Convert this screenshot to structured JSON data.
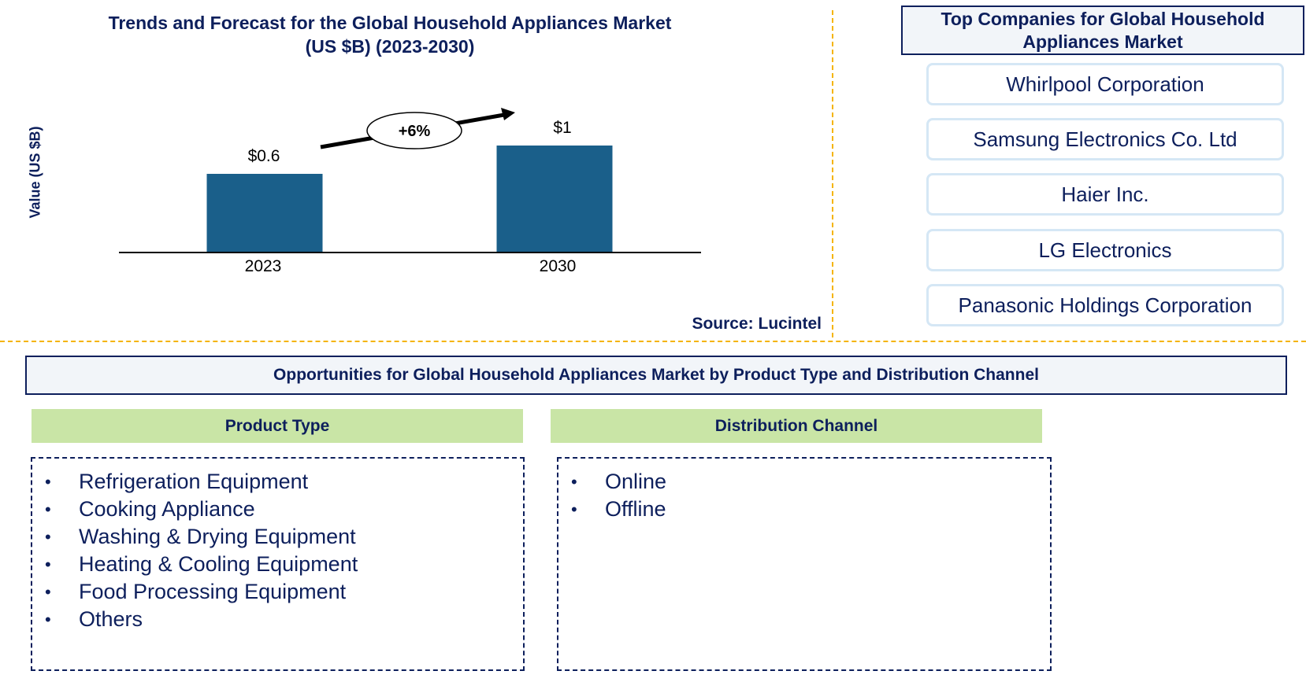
{
  "chart_data": {
    "type": "bar",
    "title": "Trends and Forecast for the Global Household Appliances Market",
    "subtitle": "(US $B) (2023-2030)",
    "xlabel": "",
    "ylabel": "Value (US $B)",
    "categories": [
      "2023",
      "2030"
    ],
    "values": [
      0.6,
      1
    ],
    "data_labels": [
      "$0.6",
      "$1"
    ],
    "ylim": [
      0,
      1.6
    ],
    "grid": false,
    "bar_color": "#1a5f8a",
    "annotation": {
      "text": "+6%",
      "meaning": "CAGR 2023-2030"
    },
    "source": "Source: Lucintel"
  },
  "top_companies": {
    "title": "Top Companies for Global Household Appliances Market",
    "items": [
      "Whirlpool Corporation",
      "Samsung Electronics Co. Ltd",
      "Haier Inc.",
      "LG Electronics",
      "Panasonic Holdings Corporation"
    ]
  },
  "opportunities": {
    "title": "Opportunities for Global Household Appliances Market  by Product Type and Distribution Channel",
    "segments": [
      {
        "heading": "Product Type",
        "items": [
          "Refrigeration Equipment",
          "Cooking Appliance",
          "Washing & Drying Equipment",
          "Heating & Cooling Equipment",
          "Food Processing Equipment",
          "Others"
        ]
      },
      {
        "heading": "Distribution Channel",
        "items": [
          "Online",
          "Offline"
        ]
      }
    ]
  },
  "colors": {
    "navy": "#0d1f5c",
    "bar": "#1a5f8a",
    "divider": "#f5b400",
    "segment_header": "#c9e5a6",
    "company_border": "#d5e7f5"
  }
}
